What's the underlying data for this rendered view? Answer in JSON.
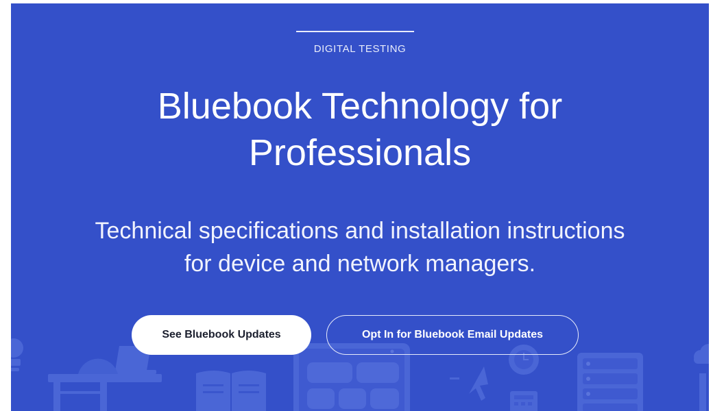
{
  "hero": {
    "eyebrow": "DIGITAL TESTING",
    "headline_line1": "Bluebook Technology for",
    "headline_line2": "Professionals",
    "subhead_line1": "Technical specifications and installation instructions",
    "subhead_line2": "for device and network managers."
  },
  "actions": {
    "primary_label": "See Bluebook Updates",
    "secondary_label": "Opt In for Bluebook Email Updates"
  },
  "colors": {
    "hero_background": "#3450c9",
    "illustration": "#4a66d6",
    "button_primary_bg": "#ffffff",
    "button_primary_text": "#1b1f2e"
  },
  "illustration": {
    "icons": [
      "lightbulb-icon",
      "laptop-icon",
      "desk-icon",
      "open-book-icon",
      "tablet-icon",
      "cursor-icon",
      "clock-icon",
      "calculator-icon",
      "server-icon",
      "cloud-icon"
    ]
  }
}
